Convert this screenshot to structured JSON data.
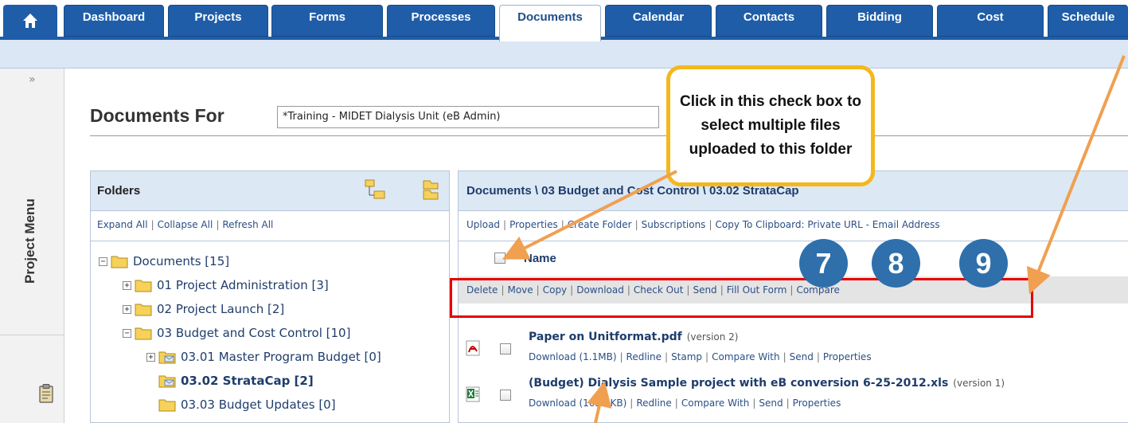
{
  "tabs": [
    {
      "label": "Dashboard",
      "active": false
    },
    {
      "label": "Projects",
      "active": false
    },
    {
      "label": "Forms",
      "active": false
    },
    {
      "label": "Processes",
      "active": false
    },
    {
      "label": "Documents",
      "active": true
    },
    {
      "label": "Calendar",
      "active": false
    },
    {
      "label": "Contacts",
      "active": false
    },
    {
      "label": "Bidding",
      "active": false
    },
    {
      "label": "Cost",
      "active": false
    },
    {
      "label": "Schedule",
      "active": false
    }
  ],
  "home_icon": "home-icon",
  "project_menu": {
    "collapse_glyph": "»",
    "label": "Project Menu",
    "icon": "clipboard-icon"
  },
  "page": {
    "title": "Documents For",
    "project_value": "*Training - MIDET Dialysis Unit (eB Admin)"
  },
  "folders": {
    "header": "Folders",
    "links": [
      "Expand All",
      "Collapse All",
      "Refresh All"
    ],
    "tree": [
      {
        "label": "Documents [15]",
        "toggle": "−",
        "bold": false
      },
      {
        "label": "01 Project Administration [3]",
        "toggle": "+",
        "bold": false
      },
      {
        "label": "02 Project Launch [2]",
        "toggle": "+",
        "bold": false
      },
      {
        "label": "03 Budget and Cost Control [10]",
        "toggle": "−",
        "bold": false
      },
      {
        "label": "03.01 Master Program Budget [0]",
        "toggle": "+",
        "bold": false
      },
      {
        "label": "03.02 StrataCap [2]",
        "toggle": "",
        "bold": true
      },
      {
        "label": "03.03 Budget Updates [0]",
        "toggle": "",
        "bold": false
      }
    ]
  },
  "documents": {
    "path": "Documents \\ 03 Budget and Cost Control \\ 03.02 StrataCap",
    "links": [
      "Upload",
      "Properties",
      "Create Folder",
      "Subscriptions",
      "Copy To Clipboard: Private URL - Email Address"
    ],
    "name_header": "Name",
    "actions": [
      "Delete",
      "Move",
      "Copy",
      "Download",
      "Check Out",
      "Send",
      "Fill Out Form",
      "Compare"
    ],
    "files": [
      {
        "title": "Paper on Unitformat.pdf",
        "version": "(version 2)",
        "icon": "pdf-file-icon",
        "sub_links": [
          "Download (1.1MB)",
          "Redline",
          "Stamp",
          "Compare With",
          "Send",
          "Properties"
        ]
      },
      {
        "title": "(Budget) Dialysis Sample project with eB conversion 6-25-2012.xls",
        "version": "(version 1)",
        "icon": "excel-file-icon",
        "sub_links": [
          "Download (163.0KB)",
          "Redline",
          "Compare With",
          "Send",
          "Properties"
        ]
      }
    ]
  },
  "callout": {
    "text": "Click in this check box to select multiple files uploaded to this folder"
  },
  "badges": [
    "7",
    "8",
    "9"
  ],
  "colors": {
    "tab_blue": "#1f5da8",
    "callout_border": "#f5b81c",
    "highlight_red": "#e60000",
    "badge_blue": "#2f6fab",
    "arrow_orange": "#f0a050"
  }
}
